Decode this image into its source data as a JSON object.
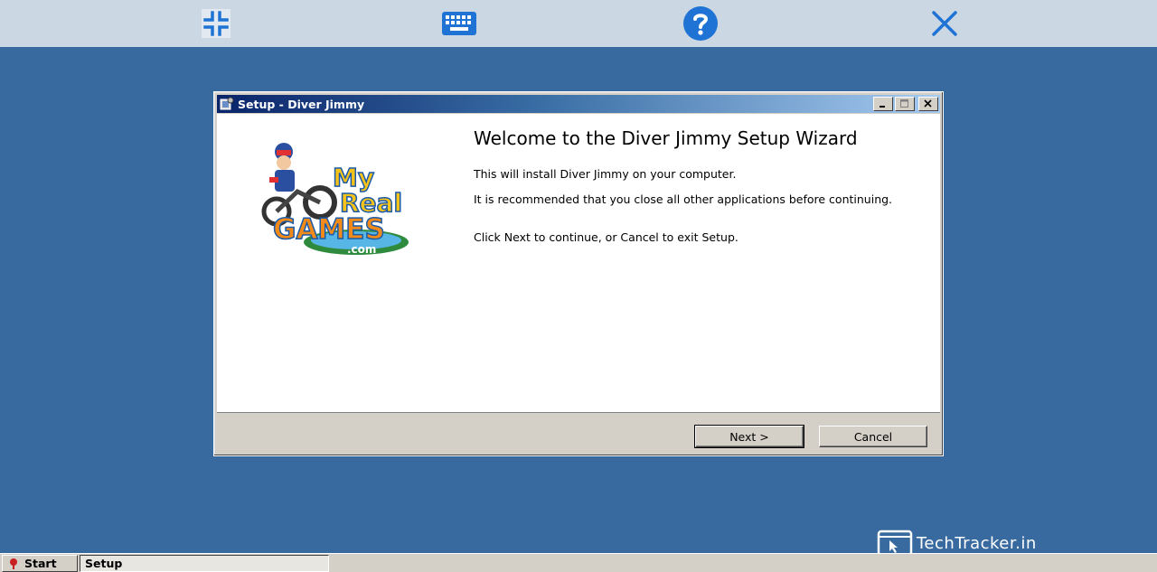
{
  "toolbar": {
    "icons": [
      "exit-fullscreen-icon",
      "keyboard-icon",
      "help-icon",
      "close-icon"
    ],
    "accent": "#1e73d4"
  },
  "window": {
    "title": "Setup - Diver Jimmy",
    "logo_text": {
      "line1": "My",
      "line2": "Real",
      "line3": "GAMES",
      "line4": ".com"
    },
    "heading": "Welcome to the Diver Jimmy Setup Wizard",
    "paragraph1": "This will install Diver Jimmy on your computer.",
    "paragraph2": "It is recommended that you close all other applications before continuing.",
    "paragraph3": "Click Next to continue, or Cancel to exit Setup.",
    "next_label": "Next >",
    "cancel_label": "Cancel"
  },
  "watermark": {
    "text": "TechTracker.in"
  },
  "taskbar": {
    "start_label": "Start",
    "task_label": "Setup"
  },
  "colors": {
    "desktop": "#386a9f",
    "toolbar_bg": "#ccd7e4",
    "window_face": "#d4d0c8",
    "titlebar_start": "#0a246a",
    "titlebar_end": "#a6caf0"
  }
}
